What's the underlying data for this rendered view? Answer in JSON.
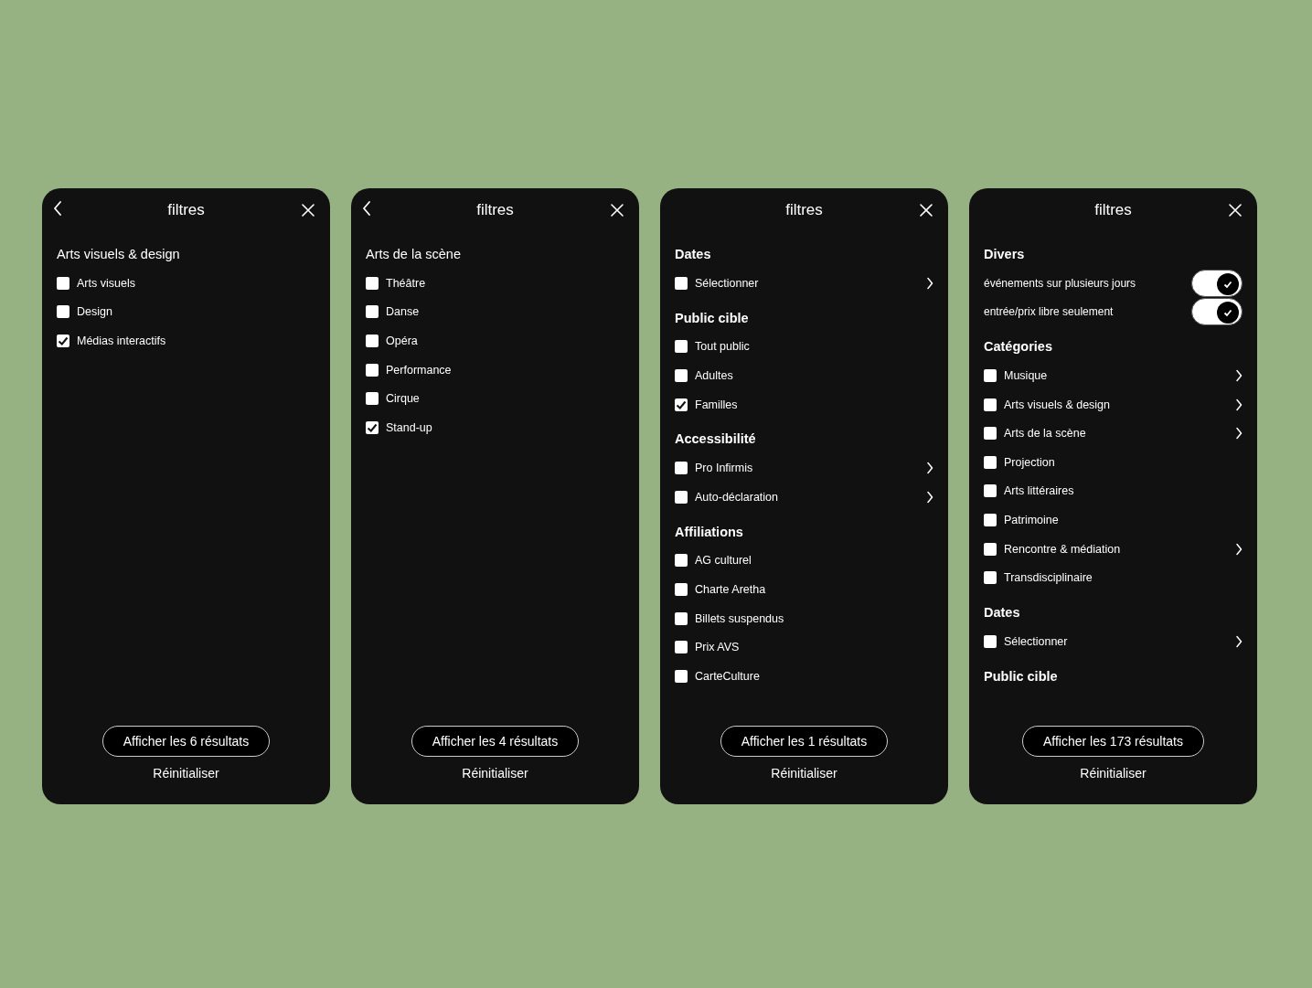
{
  "screens": [
    {
      "back": true,
      "title": "filtres",
      "sections": [
        {
          "heading": "Arts visuels & design",
          "kind": "category",
          "items": [
            {
              "kind": "checkbox",
              "label": "Arts visuels",
              "checked": false,
              "chevron": false
            },
            {
              "kind": "checkbox",
              "label": "Design",
              "checked": false,
              "chevron": false
            },
            {
              "kind": "checkbox",
              "label": "Médias interactifs",
              "checked": true,
              "chevron": false
            }
          ]
        }
      ],
      "results_button": "Afficher les 6 résultats",
      "reset": "Réinitialiser"
    },
    {
      "back": true,
      "title": "filtres",
      "sections": [
        {
          "heading": "Arts de la scène",
          "kind": "category",
          "items": [
            {
              "kind": "checkbox",
              "label": "Théâtre",
              "checked": false,
              "chevron": false
            },
            {
              "kind": "checkbox",
              "label": "Danse",
              "checked": false,
              "chevron": false
            },
            {
              "kind": "checkbox",
              "label": "Opéra",
              "checked": false,
              "chevron": false
            },
            {
              "kind": "checkbox",
              "label": "Performance",
              "checked": false,
              "chevron": false
            },
            {
              "kind": "checkbox",
              "label": "Cirque",
              "checked": false,
              "chevron": false
            },
            {
              "kind": "checkbox",
              "label": "Stand-up",
              "checked": true,
              "chevron": false
            }
          ]
        }
      ],
      "results_button": "Afficher les 4 résultats",
      "reset": "Réinitialiser"
    },
    {
      "back": false,
      "title": "filtres",
      "sections": [
        {
          "heading": "Dates",
          "kind": "group",
          "items": [
            {
              "kind": "checkbox",
              "label": "Sélectionner",
              "checked": false,
              "chevron": true
            }
          ]
        },
        {
          "heading": "Public cible",
          "kind": "group",
          "items": [
            {
              "kind": "checkbox",
              "label": "Tout public",
              "checked": false,
              "chevron": false
            },
            {
              "kind": "checkbox",
              "label": "Adultes",
              "checked": false,
              "chevron": false
            },
            {
              "kind": "checkbox",
              "label": "Familles",
              "checked": true,
              "chevron": false
            }
          ]
        },
        {
          "heading": "Accessibilité",
          "kind": "group",
          "items": [
            {
              "kind": "checkbox",
              "label": "Pro Infirmis",
              "checked": false,
              "chevron": true
            },
            {
              "kind": "checkbox",
              "label": "Auto-déclaration",
              "checked": false,
              "chevron": true
            }
          ]
        },
        {
          "heading": "Affiliations",
          "kind": "group",
          "items": [
            {
              "kind": "checkbox",
              "label": "AG culturel",
              "checked": false,
              "chevron": false
            },
            {
              "kind": "checkbox",
              "label": "Charte Aretha",
              "checked": false,
              "chevron": false
            },
            {
              "kind": "checkbox",
              "label": "Billets suspendus",
              "checked": false,
              "chevron": false
            },
            {
              "kind": "checkbox",
              "label": "Prix AVS",
              "checked": false,
              "chevron": false
            },
            {
              "kind": "checkbox",
              "label": "CarteCulture",
              "checked": false,
              "chevron": false
            }
          ]
        }
      ],
      "results_button": "Afficher les 1 résultats",
      "reset": "Réinitialiser"
    },
    {
      "back": false,
      "title": "filtres",
      "sections": [
        {
          "heading": "Divers",
          "kind": "group",
          "items": [
            {
              "kind": "toggle",
              "label": "événements sur plusieurs jours",
              "checked": true,
              "chevron": false
            },
            {
              "kind": "toggle",
              "label": "entrée/prix libre seulement",
              "checked": true,
              "chevron": false
            }
          ]
        },
        {
          "heading": "Catégories",
          "kind": "group",
          "items": [
            {
              "kind": "checkbox",
              "label": "Musique",
              "checked": false,
              "chevron": true
            },
            {
              "kind": "checkbox",
              "label": "Arts visuels & design",
              "checked": false,
              "chevron": true
            },
            {
              "kind": "checkbox",
              "label": "Arts de la scène",
              "checked": false,
              "chevron": true
            },
            {
              "kind": "checkbox",
              "label": "Projection",
              "checked": false,
              "chevron": false
            },
            {
              "kind": "checkbox",
              "label": "Arts littéraires",
              "checked": false,
              "chevron": false
            },
            {
              "kind": "checkbox",
              "label": "Patrimoine",
              "checked": false,
              "chevron": false
            },
            {
              "kind": "checkbox",
              "label": "Rencontre & médiation",
              "checked": false,
              "chevron": true
            },
            {
              "kind": "checkbox",
              "label": "Transdisciplinaire",
              "checked": false,
              "chevron": false
            }
          ]
        },
        {
          "heading": "Dates",
          "kind": "group",
          "items": [
            {
              "kind": "checkbox",
              "label": "Sélectionner",
              "checked": false,
              "chevron": true
            }
          ]
        },
        {
          "heading": "Public cible",
          "kind": "group"
        }
      ],
      "results_button": "Afficher les 173 résultats",
      "reset": "Réinitialiser"
    }
  ]
}
